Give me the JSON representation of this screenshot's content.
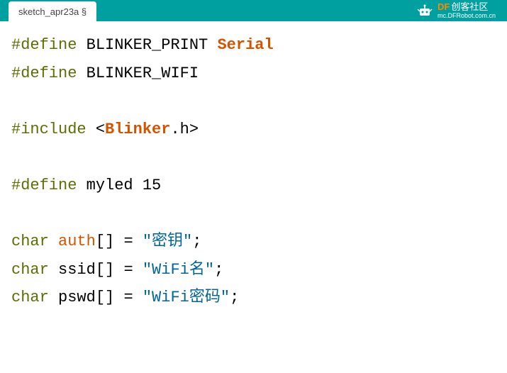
{
  "header": {
    "tab_label": "sketch_apr23a §",
    "logo_brand": "DF",
    "logo_brand_cn": "创客社区",
    "logo_url": "mc.DFRobot.com.cn"
  },
  "code": {
    "line1_define": "#define",
    "line1_macro": "BLINKER_PRINT",
    "line1_value": "Serial",
    "line2_define": "#define",
    "line2_macro": "BLINKER_WIFI",
    "line4_include": "#include",
    "line4_lt": "<",
    "line4_header": "Blinker",
    "line4_ext": ".h>",
    "line6_define": "#define",
    "line6_macro": "myled",
    "line6_value": "15",
    "char_type": "char",
    "auth_var": "auth",
    "brackets": "[]",
    "equals": "=",
    "auth_str": "\"密钥\"",
    "semi": ";",
    "ssid_var": "ssid",
    "ssid_str": "\"WiFi名\"",
    "pswd_var": "pswd",
    "pswd_str": "\"WiFi密码\""
  }
}
